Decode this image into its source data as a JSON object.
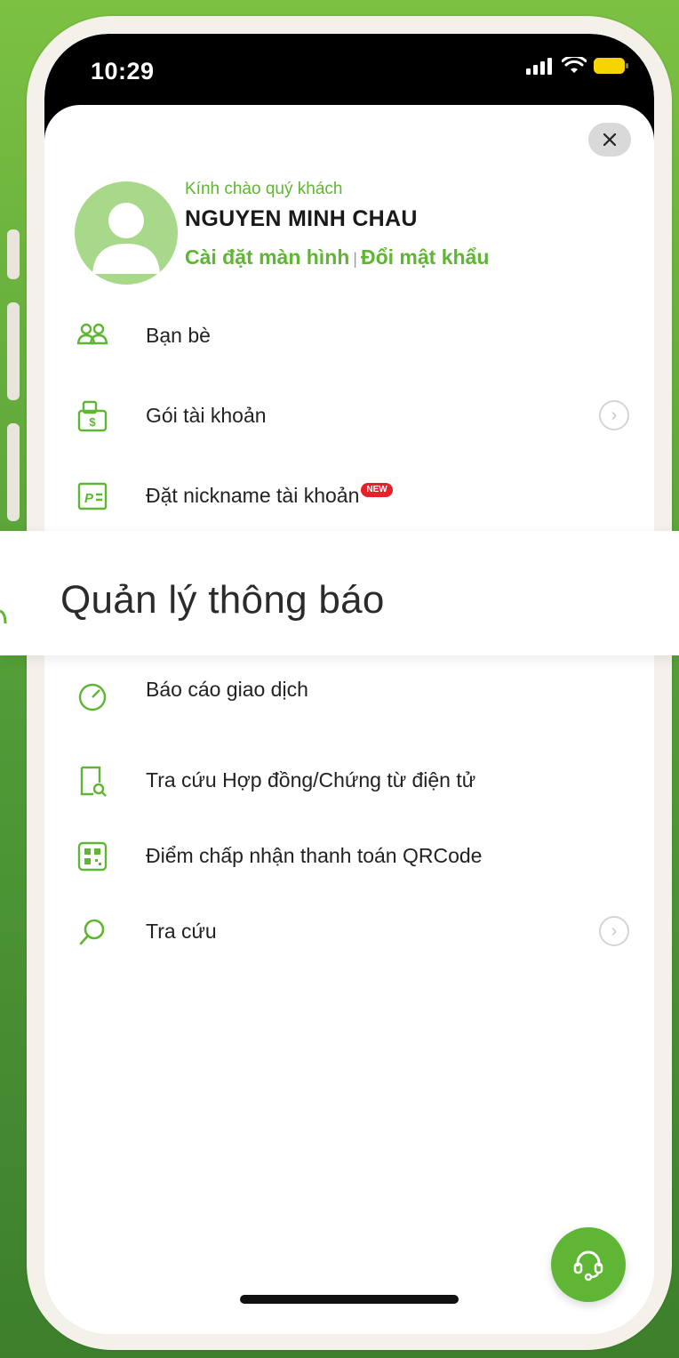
{
  "status": {
    "time": "10:29"
  },
  "profile": {
    "greeting": "Kính chào quý khách",
    "name": "NGUYEN MINH CHAU",
    "link_screen_settings": "Cài đặt màn hình",
    "link_separator": "|",
    "link_change_password": "Đổi mật khẩu"
  },
  "menu": {
    "items": [
      {
        "label": "Bạn bè",
        "icon": "friends-icon",
        "has_chevron": false
      },
      {
        "label": "Gói tài khoản",
        "icon": "account-package-icon",
        "has_chevron": true
      },
      {
        "label": "Đặt nickname tài khoản",
        "icon": "nickname-icon",
        "has_chevron": false,
        "badge": "NEW"
      },
      {
        "label": "Báo cáo giao dịch",
        "icon": "transaction-report-icon",
        "has_chevron": false
      },
      {
        "label": "Tra cứu Hợp đồng/Chứng từ điện tử",
        "icon": "contract-lookup-icon",
        "has_chevron": false
      },
      {
        "label": "Điểm chấp nhận thanh toán QRCode",
        "icon": "qrcode-icon",
        "has_chevron": false
      },
      {
        "label": "Tra cứu",
        "icon": "search-icon",
        "has_chevron": true
      }
    ]
  },
  "highlight": {
    "label": "Quản lý thông báo"
  },
  "colors": {
    "accent": "#5fb534",
    "badge": "#e8202a",
    "background_green": "#5aa83a"
  }
}
